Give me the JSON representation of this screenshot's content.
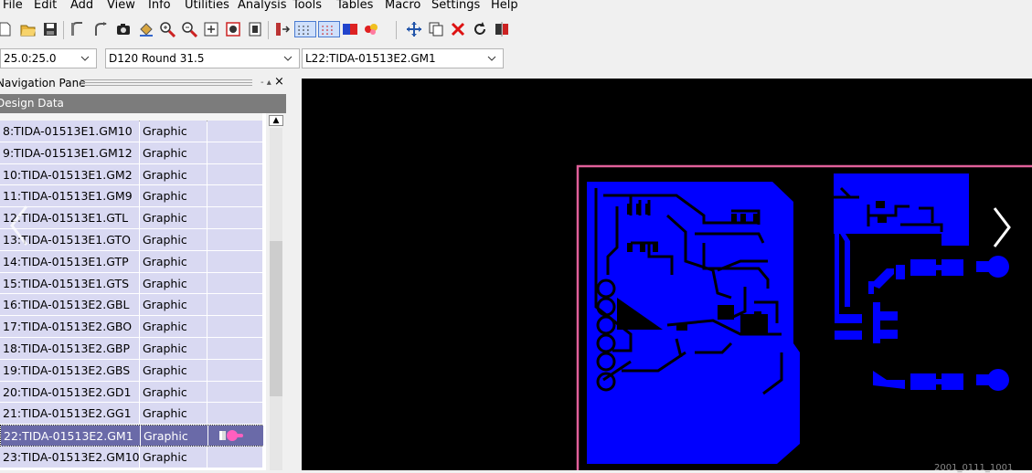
{
  "menu": [
    "File",
    "Edit",
    "Add",
    "View",
    "Info",
    "Utilities",
    "Analysis",
    "Tools",
    "Tables",
    "Macro",
    "Settings",
    "Help"
  ],
  "toolbar": {
    "icons": [
      "new-file",
      "open-folder",
      "save",
      "undo-arc",
      "redo-arc",
      "camera",
      "paint-bucket",
      "zoom-in",
      "zoom-out",
      "zoom-window",
      "zoom-extents",
      "zoom-fit",
      "pan-view",
      "grid-toggle",
      "dot-grid",
      "layer-color",
      "highlight",
      "move",
      "copy",
      "delete",
      "rotate",
      "mirror"
    ]
  },
  "combos": {
    "zoom_value": "25.0:25.0",
    "aperture_value": "D120 Round 31.5",
    "layer_value": "L22:TIDA-01513E2.GM1"
  },
  "nav": {
    "title": "Navigation Pane",
    "pin_glyph": "- ▴",
    "close_glyph": "×",
    "header": "Design Data",
    "rows": [
      {
        "name": "8:TIDA-01513E1.GM10",
        "type": "Graphic",
        "selected": false
      },
      {
        "name": "9:TIDA-01513E1.GM12",
        "type": "Graphic",
        "selected": false
      },
      {
        "name": "10:TIDA-01513E1.GM2",
        "type": "Graphic",
        "selected": false
      },
      {
        "name": "11:TIDA-01513E1.GM9",
        "type": "Graphic",
        "selected": false
      },
      {
        "name": "12:TIDA-01513E1.GTL",
        "type": "Graphic",
        "selected": false
      },
      {
        "name": "13:TIDA-01513E1.GTO",
        "type": "Graphic",
        "selected": false
      },
      {
        "name": "14:TIDA-01513E1.GTP",
        "type": "Graphic",
        "selected": false
      },
      {
        "name": "15:TIDA-01513E1.GTS",
        "type": "Graphic",
        "selected": false
      },
      {
        "name": "16:TIDA-01513E2.GBL",
        "type": "Graphic",
        "selected": false
      },
      {
        "name": "17:TIDA-01513E2.GBO",
        "type": "Graphic",
        "selected": false
      },
      {
        "name": "18:TIDA-01513E2.GBP",
        "type": "Graphic",
        "selected": false
      },
      {
        "name": "19:TIDA-01513E2.GBS",
        "type": "Graphic",
        "selected": false
      },
      {
        "name": "20:TIDA-01513E2.GD1",
        "type": "Graphic",
        "selected": false
      },
      {
        "name": "21:TIDA-01513E2.GG1",
        "type": "Graphic",
        "selected": false
      },
      {
        "name": "22:TIDA-01513E2.GM1",
        "type": "Graphic",
        "selected": true
      },
      {
        "name": "23:TIDA-01513E2.GM10",
        "type": "Graphic",
        "selected": false
      }
    ]
  },
  "colors": {
    "copper": "#0000ff",
    "board_outline": "#e0609a",
    "canvas_bg": "#000000",
    "row_bg": "#d9d9f2",
    "row_selected": "#6a6aa8"
  },
  "status": {
    "coord_readout": "2001_0111_1001"
  }
}
